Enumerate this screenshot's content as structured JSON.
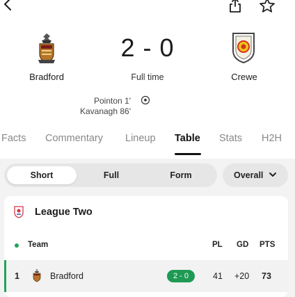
{
  "header": {
    "back_icon": "chevron-left-icon",
    "share_icon": "share-icon",
    "favorite_icon": "star-outline-icon"
  },
  "match": {
    "home_team": "Bradford",
    "away_team": "Crewe",
    "score": "2 - 0",
    "status": "Full time",
    "scorers": [
      "Pointon 1'",
      "Kavanagh 86'"
    ],
    "goal_icon": "football-icon",
    "home_color": "#b5762a",
    "away_color": "#d4351c"
  },
  "tabs": [
    "Facts",
    "Commentary",
    "Lineup",
    "Table",
    "Stats",
    "H2H"
  ],
  "active_tab": "Table",
  "table_filters": {
    "options": [
      "Short",
      "Full",
      "Form"
    ],
    "selected": "Short",
    "dropdown_label": "Overall"
  },
  "league": {
    "name": "League Two",
    "columns": {
      "team": "Team",
      "pl": "PL",
      "gd": "GD",
      "pts": "PTS"
    },
    "rows": [
      {
        "position": "1",
        "team": "Bradford",
        "result": "2 - 0",
        "pl": "41",
        "gd": "+20",
        "pts": "73"
      }
    ]
  },
  "colors": {
    "accent_green": "#1f9a54",
    "dot_green": "#1fa45a"
  }
}
